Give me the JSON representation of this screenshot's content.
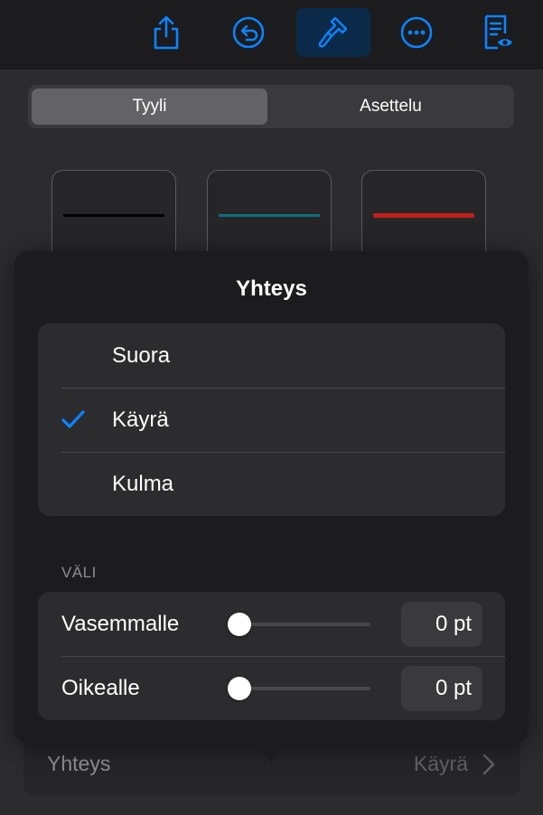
{
  "colors": {
    "accent": "#0a84ff",
    "active_bg": "#0b2a49"
  },
  "toolbar": {
    "buttons": [
      {
        "icon": "share-icon",
        "active": false
      },
      {
        "icon": "undo-icon",
        "active": false
      },
      {
        "icon": "paintbrush-icon",
        "active": true
      },
      {
        "icon": "more-icon",
        "active": false
      },
      {
        "icon": "reading-view-icon",
        "active": false
      }
    ]
  },
  "segmented": {
    "style_label": "Tyyli",
    "arrange_label": "Asettelu",
    "selected": "style_label"
  },
  "line_styles": [
    {
      "color": "#000000"
    },
    {
      "color": "#0a6f80"
    },
    {
      "color": "#c0201a"
    }
  ],
  "bottom_row": {
    "label": "Yhteys",
    "value": "Käyrä"
  },
  "popover": {
    "title": "Yhteys",
    "options": [
      {
        "label": "Suora",
        "selected": false
      },
      {
        "label": "Käyrä",
        "selected": true
      },
      {
        "label": "Kulma",
        "selected": false
      }
    ],
    "spacing": {
      "section_label": "VÄLI",
      "left": {
        "label": "Vasemmalle",
        "value": "0 pt",
        "level": 0
      },
      "right": {
        "label": "Oikealle",
        "value": "0 pt",
        "level": 0
      }
    }
  }
}
